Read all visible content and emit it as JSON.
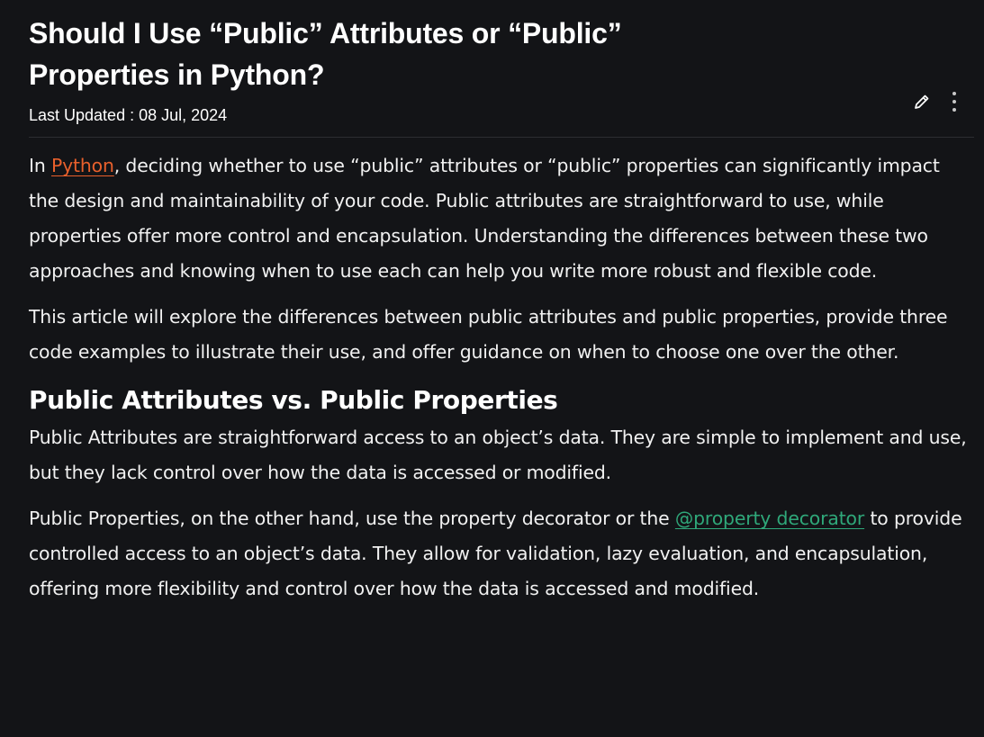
{
  "article": {
    "title": "Should I Use “Public” Attributes or “Public” Properties in Python?",
    "last_updated_label": "Last Updated : ",
    "last_updated_date": "08 Jul, 2024",
    "actions": {
      "edit_icon": "pencil-icon",
      "more_icon": "vertical-ellipsis-icon"
    }
  },
  "colors": {
    "background": "#131417",
    "text": "#f1f1f1",
    "link_orange": "#e8602c",
    "link_green": "#2fa87a"
  },
  "content": {
    "intro": {
      "prefix": "In ",
      "link": "Python",
      "rest": ", deciding whether to use “public” attributes or “public” properties can significantly impact the design and maintainability of your code. Public attributes are straightforward to use, while properties offer more control and encapsulation. Understanding the differences between these two approaches and knowing when to use each can help you write more robust and flexible code."
    },
    "overview": "This article will explore the differences between public attributes and public properties, provide three code examples to illustrate their use, and offer guidance on when to choose one over the other.",
    "section_heading": "Public Attributes vs. Public Properties",
    "attributes_paragraph": "Public Attributes are straightforward access to an object’s data. They are simple to implement and use, but they lack control over how the data is accessed or modified.",
    "properties_paragraph": {
      "prefix": "Public Properties, on the other hand, use the property decorator or the ",
      "link": "@property decorator",
      "rest": " to provide controlled access to an object’s data. They allow for validation, lazy evaluation, and encapsulation, offering more flexibility and control over how the data is accessed and modified."
    }
  }
}
